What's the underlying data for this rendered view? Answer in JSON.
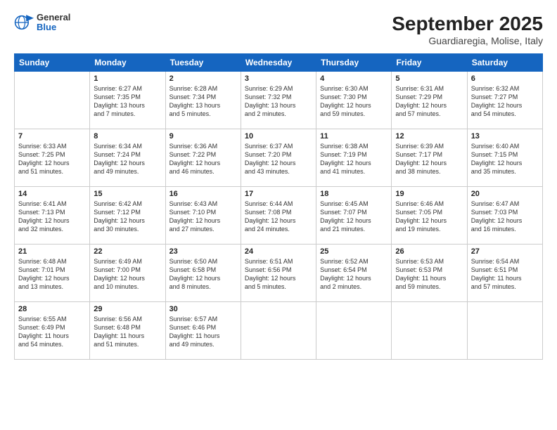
{
  "header": {
    "logo_general": "General",
    "logo_blue": "Blue",
    "month_title": "September 2025",
    "location": "Guardiaregia, Molise, Italy"
  },
  "weekdays": [
    "Sunday",
    "Monday",
    "Tuesday",
    "Wednesday",
    "Thursday",
    "Friday",
    "Saturday"
  ],
  "weeks": [
    [
      {
        "day": "",
        "info": ""
      },
      {
        "day": "1",
        "info": "Sunrise: 6:27 AM\nSunset: 7:35 PM\nDaylight: 13 hours\nand 7 minutes."
      },
      {
        "day": "2",
        "info": "Sunrise: 6:28 AM\nSunset: 7:34 PM\nDaylight: 13 hours\nand 5 minutes."
      },
      {
        "day": "3",
        "info": "Sunrise: 6:29 AM\nSunset: 7:32 PM\nDaylight: 13 hours\nand 2 minutes."
      },
      {
        "day": "4",
        "info": "Sunrise: 6:30 AM\nSunset: 7:30 PM\nDaylight: 12 hours\nand 59 minutes."
      },
      {
        "day": "5",
        "info": "Sunrise: 6:31 AM\nSunset: 7:29 PM\nDaylight: 12 hours\nand 57 minutes."
      },
      {
        "day": "6",
        "info": "Sunrise: 6:32 AM\nSunset: 7:27 PM\nDaylight: 12 hours\nand 54 minutes."
      }
    ],
    [
      {
        "day": "7",
        "info": "Sunrise: 6:33 AM\nSunset: 7:25 PM\nDaylight: 12 hours\nand 51 minutes."
      },
      {
        "day": "8",
        "info": "Sunrise: 6:34 AM\nSunset: 7:24 PM\nDaylight: 12 hours\nand 49 minutes."
      },
      {
        "day": "9",
        "info": "Sunrise: 6:36 AM\nSunset: 7:22 PM\nDaylight: 12 hours\nand 46 minutes."
      },
      {
        "day": "10",
        "info": "Sunrise: 6:37 AM\nSunset: 7:20 PM\nDaylight: 12 hours\nand 43 minutes."
      },
      {
        "day": "11",
        "info": "Sunrise: 6:38 AM\nSunset: 7:19 PM\nDaylight: 12 hours\nand 41 minutes."
      },
      {
        "day": "12",
        "info": "Sunrise: 6:39 AM\nSunset: 7:17 PM\nDaylight: 12 hours\nand 38 minutes."
      },
      {
        "day": "13",
        "info": "Sunrise: 6:40 AM\nSunset: 7:15 PM\nDaylight: 12 hours\nand 35 minutes."
      }
    ],
    [
      {
        "day": "14",
        "info": "Sunrise: 6:41 AM\nSunset: 7:13 PM\nDaylight: 12 hours\nand 32 minutes."
      },
      {
        "day": "15",
        "info": "Sunrise: 6:42 AM\nSunset: 7:12 PM\nDaylight: 12 hours\nand 30 minutes."
      },
      {
        "day": "16",
        "info": "Sunrise: 6:43 AM\nSunset: 7:10 PM\nDaylight: 12 hours\nand 27 minutes."
      },
      {
        "day": "17",
        "info": "Sunrise: 6:44 AM\nSunset: 7:08 PM\nDaylight: 12 hours\nand 24 minutes."
      },
      {
        "day": "18",
        "info": "Sunrise: 6:45 AM\nSunset: 7:07 PM\nDaylight: 12 hours\nand 21 minutes."
      },
      {
        "day": "19",
        "info": "Sunrise: 6:46 AM\nSunset: 7:05 PM\nDaylight: 12 hours\nand 19 minutes."
      },
      {
        "day": "20",
        "info": "Sunrise: 6:47 AM\nSunset: 7:03 PM\nDaylight: 12 hours\nand 16 minutes."
      }
    ],
    [
      {
        "day": "21",
        "info": "Sunrise: 6:48 AM\nSunset: 7:01 PM\nDaylight: 12 hours\nand 13 minutes."
      },
      {
        "day": "22",
        "info": "Sunrise: 6:49 AM\nSunset: 7:00 PM\nDaylight: 12 hours\nand 10 minutes."
      },
      {
        "day": "23",
        "info": "Sunrise: 6:50 AM\nSunset: 6:58 PM\nDaylight: 12 hours\nand 8 minutes."
      },
      {
        "day": "24",
        "info": "Sunrise: 6:51 AM\nSunset: 6:56 PM\nDaylight: 12 hours\nand 5 minutes."
      },
      {
        "day": "25",
        "info": "Sunrise: 6:52 AM\nSunset: 6:54 PM\nDaylight: 12 hours\nand 2 minutes."
      },
      {
        "day": "26",
        "info": "Sunrise: 6:53 AM\nSunset: 6:53 PM\nDaylight: 11 hours\nand 59 minutes."
      },
      {
        "day": "27",
        "info": "Sunrise: 6:54 AM\nSunset: 6:51 PM\nDaylight: 11 hours\nand 57 minutes."
      }
    ],
    [
      {
        "day": "28",
        "info": "Sunrise: 6:55 AM\nSunset: 6:49 PM\nDaylight: 11 hours\nand 54 minutes."
      },
      {
        "day": "29",
        "info": "Sunrise: 6:56 AM\nSunset: 6:48 PM\nDaylight: 11 hours\nand 51 minutes."
      },
      {
        "day": "30",
        "info": "Sunrise: 6:57 AM\nSunset: 6:46 PM\nDaylight: 11 hours\nand 49 minutes."
      },
      {
        "day": "",
        "info": ""
      },
      {
        "day": "",
        "info": ""
      },
      {
        "day": "",
        "info": ""
      },
      {
        "day": "",
        "info": ""
      }
    ]
  ]
}
